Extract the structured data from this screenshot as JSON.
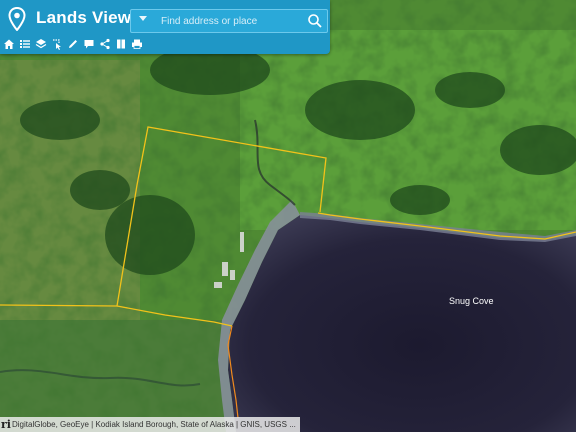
{
  "app": {
    "title": "Lands Viewer"
  },
  "search": {
    "placeholder": "Find address or place"
  },
  "toolbar": {
    "items": [
      {
        "icon": "home-icon"
      },
      {
        "icon": "list-icon"
      },
      {
        "icon": "layers-icon"
      },
      {
        "icon": "select-icon"
      },
      {
        "icon": "pencil-icon"
      },
      {
        "icon": "comment-icon"
      },
      {
        "icon": "share-icon"
      },
      {
        "icon": "bookmark-icon"
      },
      {
        "icon": "print-icon"
      }
    ]
  },
  "map": {
    "place_label": "Snug Cove",
    "attribution": "DigitalGlobe, GeoEye | Kodiak Island Borough, State of Alaska | GNIS, USGS ...",
    "boundary_color": "#f2c21a",
    "shoreline_color": "#f08a1e"
  },
  "colors": {
    "header": "#1f97c6",
    "search_bg": "#2aa9d9",
    "water": "#1a1a2e"
  }
}
